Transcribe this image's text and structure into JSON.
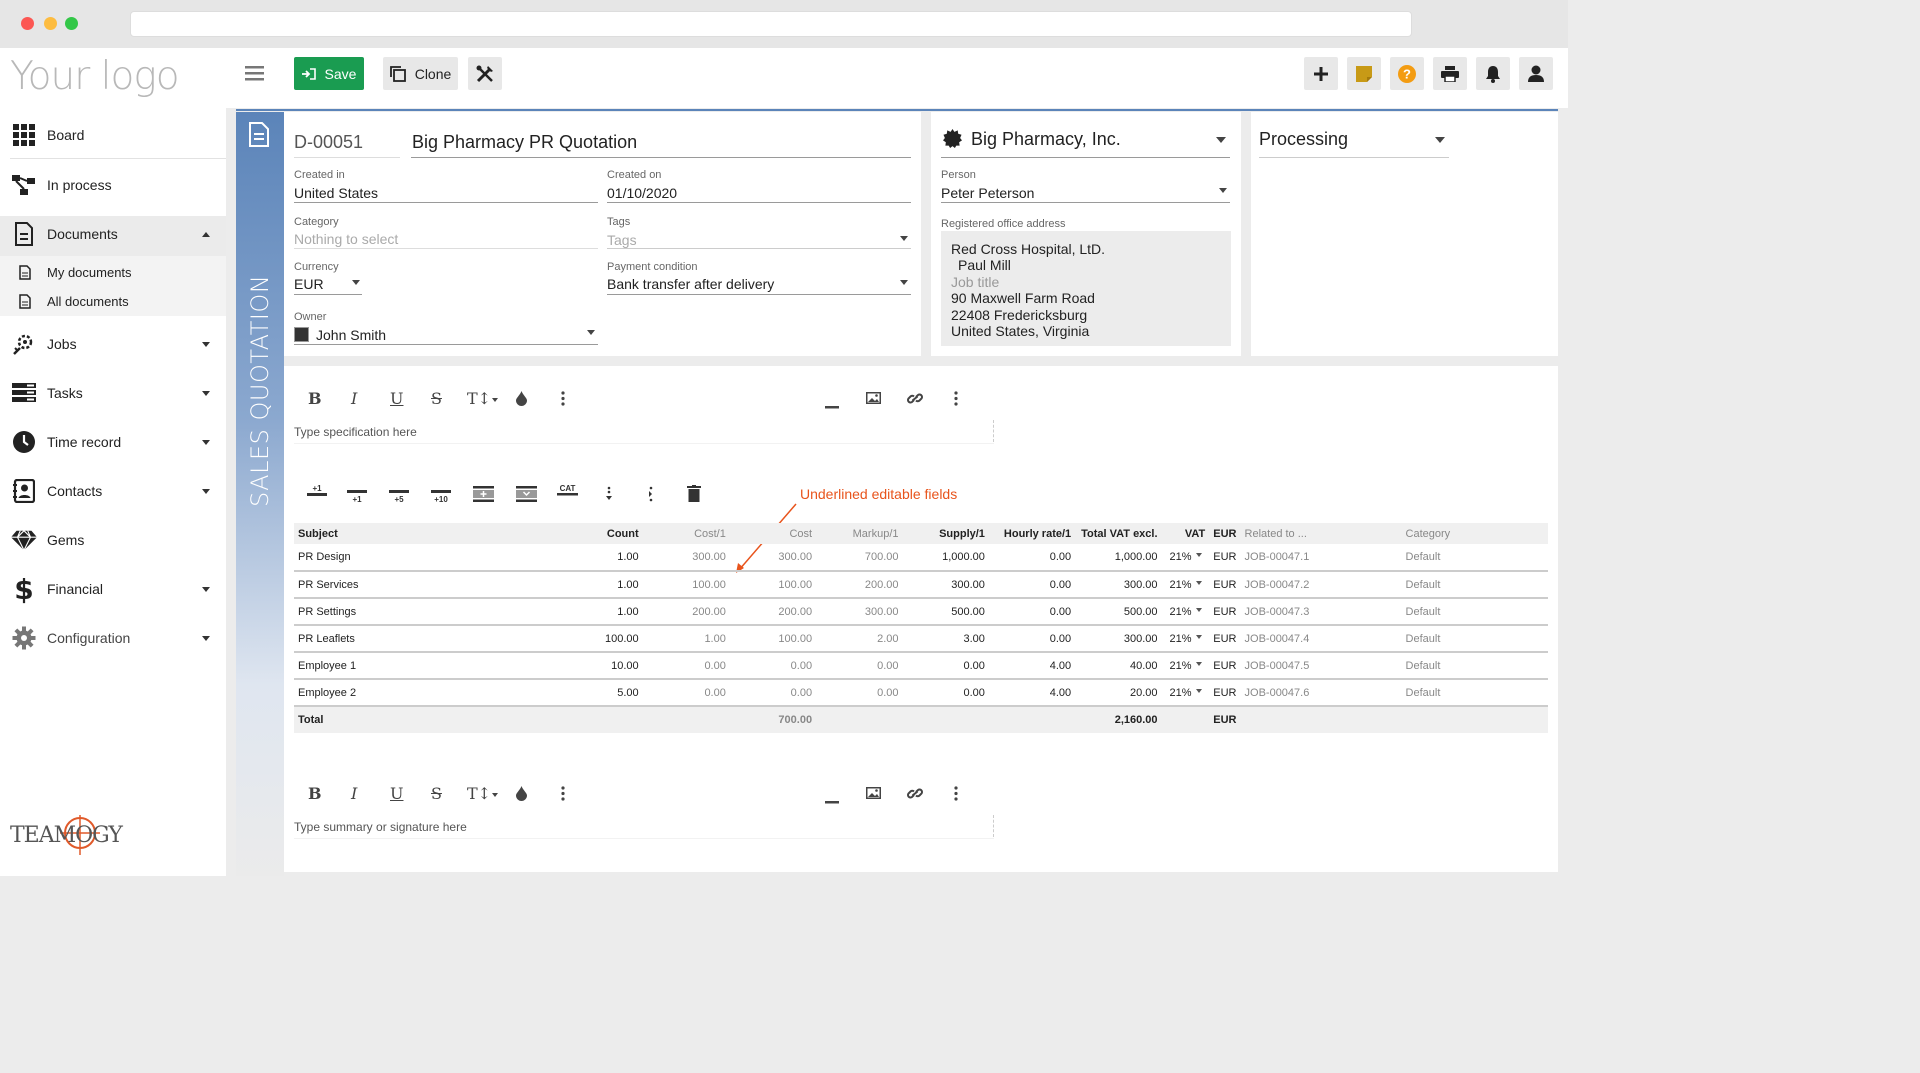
{
  "sidebar": {
    "logo": "Your logo",
    "brand": "TEAMOGY",
    "items": [
      {
        "label": "Board",
        "icon": "grid-icon"
      },
      {
        "label": "In process",
        "icon": "process-icon"
      },
      {
        "label": "Documents",
        "icon": "document-icon"
      },
      {
        "label": "My documents",
        "icon": "document-small-icon"
      },
      {
        "label": "All documents",
        "icon": "document-small-icon"
      },
      {
        "label": "Jobs",
        "icon": "jobs-icon"
      },
      {
        "label": "Tasks",
        "icon": "tasks-icon"
      },
      {
        "label": "Time record",
        "icon": "clock-icon"
      },
      {
        "label": "Contacts",
        "icon": "contacts-icon"
      },
      {
        "label": "Gems",
        "icon": "gem-icon"
      },
      {
        "label": "Financial",
        "icon": "dollar-icon"
      },
      {
        "label": "Configuration",
        "icon": "gear-icon"
      }
    ]
  },
  "toolbar": {
    "save_label": "Save",
    "clone_label": "Clone"
  },
  "document": {
    "side_title": "SALES QUOTATION",
    "number": "D-00051",
    "title": "Big Pharmacy PR Quotation",
    "created_in_label": "Created in",
    "created_in": "United States",
    "created_on_label": "Created on",
    "created_on": "01/10/2020",
    "category_label": "Category",
    "category_placeholder": "Nothing to select",
    "tags_label": "Tags",
    "tags_placeholder": "Tags",
    "currency_label": "Currency",
    "currency": "EUR",
    "payment_label": "Payment condition",
    "payment": "Bank transfer after delivery",
    "owner_label": "Owner",
    "owner": "John Smith"
  },
  "client": {
    "company": "Big Pharmacy, Inc.",
    "person_label": "Person",
    "person": "Peter Peterson",
    "address_label": "Registered office address",
    "address_lines": [
      "Red Cross Hospital, LtD.",
      "Paul Mill",
      "Job title",
      "90 Maxwell Farm Road",
      "22408 Fredericksburg",
      "United States, Virginia"
    ]
  },
  "status": {
    "value": "Processing"
  },
  "editor": {
    "spec_placeholder": "Type specification here",
    "summary_placeholder": "Type summary or signature here",
    "style_tool": "T↕"
  },
  "row_tools": [
    "+1",
    "+1",
    "+5",
    "+10",
    "CAT"
  ],
  "annotation": "Underlined editable fields",
  "table": {
    "headers": [
      "Subject",
      "Count",
      "Cost/1",
      "Cost",
      "Markup/1",
      "Supply/1",
      "Hourly rate/1",
      "Total VAT excl.",
      "VAT",
      "EUR",
      "Related to ...",
      "Category"
    ],
    "rows": [
      [
        "PR Design",
        "1.00",
        "300.00",
        "300.00",
        "700.00",
        "1,000.00",
        "0.00",
        "1,000.00",
        "21%",
        "EUR",
        "JOB-00047.1",
        "Default"
      ],
      [
        "PR Services",
        "1.00",
        "100.00",
        "100.00",
        "200.00",
        "300.00",
        "0.00",
        "300.00",
        "21%",
        "EUR",
        "JOB-00047.2",
        "Default"
      ],
      [
        "PR Settings",
        "1.00",
        "200.00",
        "200.00",
        "300.00",
        "500.00",
        "0.00",
        "500.00",
        "21%",
        "EUR",
        "JOB-00047.3",
        "Default"
      ],
      [
        "PR Leaflets",
        "100.00",
        "1.00",
        "100.00",
        "2.00",
        "3.00",
        "0.00",
        "300.00",
        "21%",
        "EUR",
        "JOB-00047.4",
        "Default"
      ],
      [
        "Employee 1",
        "10.00",
        "0.00",
        "0.00",
        "0.00",
        "0.00",
        "4.00",
        "40.00",
        "21%",
        "EUR",
        "JOB-00047.5",
        "Default"
      ],
      [
        "Employee 2",
        "5.00",
        "0.00",
        "0.00",
        "0.00",
        "0.00",
        "4.00",
        "20.00",
        "21%",
        "EUR",
        "JOB-00047.6",
        "Default"
      ]
    ],
    "total": {
      "label": "Total",
      "cost": "700.00",
      "total_vat_excl": "2,160.00",
      "currency": "EUR"
    }
  },
  "colors": {
    "save_green": "#1a9c51",
    "accent_blue": "#5b84b9",
    "annotation_orange": "#e8541c"
  }
}
